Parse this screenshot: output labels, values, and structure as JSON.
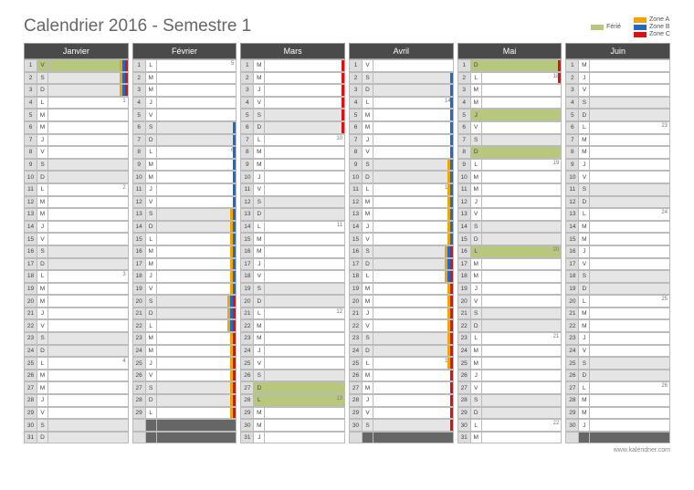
{
  "title": "Calendrier 2016 - Semestre 1",
  "footer": "www.kalendrier.com",
  "legend": {
    "ferie": "Férié",
    "zoneA": "Zone A",
    "zoneB": "Zone B",
    "zoneC": "Zone C"
  },
  "dowLetters": [
    "D",
    "L",
    "M",
    "M",
    "J",
    "V",
    "S"
  ],
  "months": [
    {
      "name": "Janvier",
      "ndays": 31,
      "startDow": 5,
      "ferie": [
        1
      ],
      "weeks": {
        "4": 1,
        "11": 2,
        "18": 3,
        "25": 4
      },
      "zones": {
        "A": [
          1,
          2,
          3
        ],
        "B": [
          1,
          2,
          3
        ],
        "C": [
          1,
          2,
          3
        ]
      }
    },
    {
      "name": "Février",
      "ndays": 29,
      "startDow": 1,
      "ferie": [],
      "weeks": {
        "1": 5,
        "8": 6,
        "15": 7,
        "22": 8,
        "29": 9
      },
      "zones": {
        "A": [
          13,
          14,
          15,
          16,
          17,
          18,
          19,
          20,
          21,
          22,
          23,
          24,
          25,
          26,
          27,
          28,
          29
        ],
        "B": [
          6,
          7,
          8,
          9,
          10,
          11,
          12,
          13,
          14,
          15,
          16,
          17,
          18,
          19,
          20,
          21,
          22
        ],
        "C": [
          20,
          21,
          22,
          23,
          24,
          25,
          26,
          27,
          28,
          29
        ]
      }
    },
    {
      "name": "Mars",
      "ndays": 31,
      "startDow": 2,
      "ferie": [
        27,
        28
      ],
      "weeks": {
        "7": 10,
        "14": 11,
        "21": 12,
        "28": 13
      },
      "zones": {
        "A": [],
        "B": [],
        "C": [
          1,
          2,
          3,
          4,
          5,
          6
        ]
      }
    },
    {
      "name": "Avril",
      "ndays": 30,
      "startDow": 5,
      "ferie": [],
      "weeks": {
        "4": 14,
        "11": 15,
        "18": 16,
        "25": 17
      },
      "zones": {
        "A": [
          9,
          10,
          11,
          12,
          13,
          14,
          15,
          16,
          17,
          18,
          19,
          20,
          21,
          22,
          23,
          24,
          25
        ],
        "B": [
          2,
          3,
          4,
          5,
          6,
          7,
          8,
          9,
          10,
          11,
          12,
          13,
          14,
          15,
          16,
          17,
          18
        ],
        "C": [
          16,
          17,
          18,
          19,
          20,
          21,
          22,
          23,
          24,
          25,
          26,
          27,
          28,
          29,
          30
        ]
      }
    },
    {
      "name": "Mai",
      "ndays": 31,
      "startDow": 0,
      "ferie": [
        1,
        5,
        8,
        16
      ],
      "weeks": {
        "2": 18,
        "9": 19,
        "16": 20,
        "23": 21,
        "30": 22
      },
      "zones": {
        "C": [
          1,
          2
        ]
      }
    },
    {
      "name": "Juin",
      "ndays": 30,
      "startDow": 3,
      "ferie": [],
      "weeks": {
        "6": 23,
        "13": 24,
        "20": 25,
        "27": 26
      },
      "zones": {}
    }
  ]
}
